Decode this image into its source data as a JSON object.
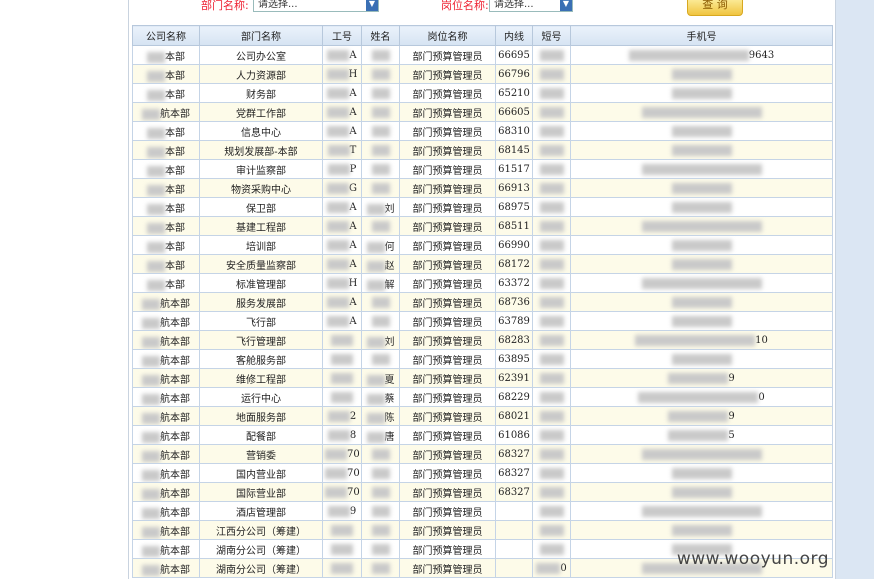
{
  "filters": {
    "dept_label": "部门名称:",
    "dept_select": "请选择...",
    "post_label": "岗位名称:",
    "post_select": "请选择...",
    "query_button": "查 询"
  },
  "table": {
    "headers": [
      "公司名称",
      "部门名称",
      "工号",
      "姓名",
      "岗位名称",
      "内线",
      "短号",
      "手机号"
    ],
    "rows": [
      {
        "company": "本部",
        "dept": "公司办公室",
        "id": "A",
        "name": "",
        "post": "部门预算管理员",
        "ext": "66695",
        "short": "",
        "mobile": "9643"
      },
      {
        "company": "本部",
        "dept": "人力资源部",
        "id": "H",
        "name": "",
        "post": "部门预算管理员",
        "ext": "66796",
        "short": "",
        "mobile": ""
      },
      {
        "company": "本部",
        "dept": "财务部",
        "id": "A",
        "name": "",
        "post": "部门预算管理员",
        "ext": "65210",
        "short": "",
        "mobile": ""
      },
      {
        "company": "航本部",
        "dept": "党群工作部",
        "id": "A",
        "name": "",
        "post": "部门预算管理员",
        "ext": "66605",
        "short": "",
        "mobile": ""
      },
      {
        "company": "本部",
        "dept": "信息中心",
        "id": "A",
        "name": "",
        "post": "部门预算管理员",
        "ext": "68310",
        "short": "",
        "mobile": ""
      },
      {
        "company": "本部",
        "dept": "规划发展部-本部",
        "id": "T",
        "name": "",
        "post": "部门预算管理员",
        "ext": "68145",
        "short": "",
        "mobile": ""
      },
      {
        "company": "本部",
        "dept": "审计监察部",
        "id": "P",
        "name": "",
        "post": "部门预算管理员",
        "ext": "61517",
        "short": "",
        "mobile": ""
      },
      {
        "company": "本部",
        "dept": "物资采购中心",
        "id": "G",
        "name": "",
        "post": "部门预算管理员",
        "ext": "66913",
        "short": "",
        "mobile": ""
      },
      {
        "company": "本部",
        "dept": "保卫部",
        "id": "A",
        "name": "刘",
        "post": "部门预算管理员",
        "ext": "68975",
        "short": "",
        "mobile": ""
      },
      {
        "company": "本部",
        "dept": "基建工程部",
        "id": "A",
        "name": "",
        "post": "部门预算管理员",
        "ext": "68511",
        "short": "",
        "mobile": ""
      },
      {
        "company": "本部",
        "dept": "培训部",
        "id": "A",
        "name": "何",
        "post": "部门预算管理员",
        "ext": "66990",
        "short": "",
        "mobile": ""
      },
      {
        "company": "本部",
        "dept": "安全质量监察部",
        "id": "A",
        "name": "赵",
        "post": "部门预算管理员",
        "ext": "68172",
        "short": "",
        "mobile": ""
      },
      {
        "company": "本部",
        "dept": "标准管理部",
        "id": "H",
        "name": "解",
        "post": "部门预算管理员",
        "ext": "63372",
        "short": "",
        "mobile": ""
      },
      {
        "company": "航本部",
        "dept": "服务发展部",
        "id": "A",
        "name": "",
        "post": "部门预算管理员",
        "ext": "68736",
        "short": "",
        "mobile": ""
      },
      {
        "company": "航本部",
        "dept": "飞行部",
        "id": "A",
        "name": "",
        "post": "部门预算管理员",
        "ext": "63789",
        "short": "",
        "mobile": ""
      },
      {
        "company": "航本部",
        "dept": "飞行管理部",
        "id": "",
        "name": "刘",
        "post": "部门预算管理员",
        "ext": "68283",
        "short": "",
        "mobile": "10"
      },
      {
        "company": "航本部",
        "dept": "客舱服务部",
        "id": "",
        "name": "",
        "post": "部门预算管理员",
        "ext": "63895",
        "short": "",
        "mobile": ""
      },
      {
        "company": "航本部",
        "dept": "维修工程部",
        "id": "",
        "name": "夏",
        "post": "部门预算管理员",
        "ext": "62391",
        "short": "",
        "mobile": "9"
      },
      {
        "company": "航本部",
        "dept": "运行中心",
        "id": "",
        "name": "蔡",
        "post": "部门预算管理员",
        "ext": "68229",
        "short": "",
        "mobile": "0"
      },
      {
        "company": "航本部",
        "dept": "地面服务部",
        "id": "2",
        "name": "陈",
        "post": "部门预算管理员",
        "ext": "68021",
        "short": "",
        "mobile": "9"
      },
      {
        "company": "航本部",
        "dept": "配餐部",
        "id": "8",
        "name": "唐",
        "post": "部门预算管理员",
        "ext": "61086",
        "short": "",
        "mobile": "5"
      },
      {
        "company": "航本部",
        "dept": "营销委",
        "id": "70",
        "name": "",
        "post": "部门预算管理员",
        "ext": "68327",
        "short": "",
        "mobile": ""
      },
      {
        "company": "航本部",
        "dept": "国内营业部",
        "id": "70",
        "name": "",
        "post": "部门预算管理员",
        "ext": "68327",
        "short": "",
        "mobile": ""
      },
      {
        "company": "航本部",
        "dept": "国际营业部",
        "id": "70",
        "name": "",
        "post": "部门预算管理员",
        "ext": "68327",
        "short": "",
        "mobile": ""
      },
      {
        "company": "航本部",
        "dept": "酒店管理部",
        "id": "9",
        "name": "",
        "post": "部门预算管理员",
        "ext": "",
        "short": "",
        "mobile": ""
      },
      {
        "company": "航本部",
        "dept": "江西分公司（筹建）",
        "id": "",
        "name": "",
        "post": "部门预算管理员",
        "ext": "",
        "short": "",
        "mobile": ""
      },
      {
        "company": "航本部",
        "dept": "湖南分公司（筹建）",
        "id": "",
        "name": "",
        "post": "部门预算管理员",
        "ext": "",
        "short": "",
        "mobile": ""
      },
      {
        "company": "航本部",
        "dept": "湖南分公司（筹建）",
        "id": "",
        "name": "",
        "post": "部门预算管理员",
        "ext": "",
        "short": "0",
        "mobile": ""
      }
    ]
  },
  "watermark": "www.wooyun.org"
}
